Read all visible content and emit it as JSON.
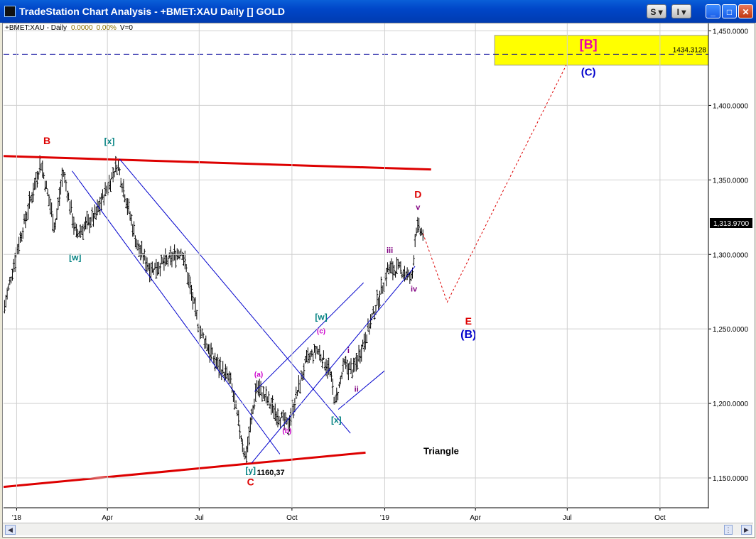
{
  "window": {
    "title": "TradeStation Chart Analysis  -  +BMET:XAU Daily [] GOLD",
    "buttons": [
      "S",
      "I",
      "_",
      "□",
      "✕"
    ]
  },
  "chart_info": {
    "symbol": "+BMET:XAU - Daily",
    "change": "0.0000",
    "change_pct": "0.00%",
    "volume": "V=0"
  },
  "colors": {
    "bars": "#000000",
    "trendlines": "#dd0000",
    "channels": "#0000cc",
    "target_box": "#ffff00",
    "dashed_level": "#000099",
    "projection": "#dd0000"
  },
  "chart_data": {
    "type": "bar",
    "title": "",
    "xlabel": "",
    "ylabel": "",
    "x_ticks": [
      "'18",
      "Apr",
      "Jul",
      "Oct",
      "'19",
      "Apr",
      "Jul",
      "Oct"
    ],
    "y_ticks": [
      "1,150.0000",
      "1,200.0000",
      "1,250.0000",
      "1,300.0000",
      "1,350.0000",
      "1,400.0000",
      "1,450.0000"
    ],
    "y_tick_values": [
      1150,
      1200,
      1250,
      1300,
      1350,
      1400,
      1450
    ],
    "ylim": [
      1130,
      1455
    ],
    "xlim": [
      "2017-12-19",
      "2019-11-18"
    ],
    "price_path": [
      [
        "2017-12-20",
        1265
      ],
      [
        "2018-01-01",
        1302
      ],
      [
        "2018-01-25",
        1362
      ],
      [
        "2018-02-08",
        1318
      ],
      [
        "2018-02-16",
        1356
      ],
      [
        "2018-03-01",
        1313
      ],
      [
        "2018-03-20",
        1326
      ],
      [
        "2018-04-11",
        1361
      ],
      [
        "2018-05-01",
        1305
      ],
      [
        "2018-05-14",
        1290
      ],
      [
        "2018-06-01",
        1296
      ],
      [
        "2018-06-14",
        1303
      ],
      [
        "2018-07-01",
        1250
      ],
      [
        "2018-07-17",
        1228
      ],
      [
        "2018-08-01",
        1215
      ],
      [
        "2018-08-16",
        1163
      ],
      [
        "2018-08-27",
        1212
      ],
      [
        "2018-09-15",
        1194
      ],
      [
        "2018-09-27",
        1185
      ],
      [
        "2018-10-15",
        1228
      ],
      [
        "2018-10-26",
        1236
      ],
      [
        "2018-11-07",
        1223
      ],
      [
        "2018-11-13",
        1200
      ],
      [
        "2018-11-22",
        1226
      ],
      [
        "2018-12-01",
        1222
      ],
      [
        "2018-12-20",
        1258
      ],
      [
        "2019-01-04",
        1290
      ],
      [
        "2019-01-17",
        1290
      ],
      [
        "2019-01-28",
        1283
      ],
      [
        "2019-02-01",
        1318
      ],
      [
        "2019-02-08",
        1314
      ]
    ],
    "last_price": "1,313.9700",
    "low_label": "1160,37",
    "target_value": "1434.3128",
    "target_level": 1434.3128,
    "target_zone": {
      "x_start": "2019-04-20",
      "x_end": "2019-11-18",
      "y_low": 1427,
      "y_high": 1447
    },
    "trendlines": [
      {
        "name": "upper-red",
        "p1": [
          "2017-12-19",
          1366
        ],
        "p2": [
          "2019-02-16",
          1357
        ]
      },
      {
        "name": "lower-red",
        "p1": [
          "2017-12-19",
          1144
        ],
        "p2": [
          "2018-12-13",
          1167
        ]
      }
    ],
    "channels": [
      {
        "p1": [
          "2018-02-25",
          1356
        ],
        "p2": [
          "2018-09-19",
          1166
        ]
      },
      {
        "p1": [
          "2018-04-13",
          1364
        ],
        "p2": [
          "2018-11-28",
          1180
        ]
      },
      {
        "p1": [
          "2018-08-22",
          1160
        ],
        "p2": [
          "2019-01-31",
          1292
        ]
      },
      {
        "p1": [
          "2018-08-25",
          1208
        ],
        "p2": [
          "2018-12-11",
          1281
        ]
      },
      {
        "p1": [
          "2018-11-16",
          1196
        ],
        "p2": [
          "2019-01-01",
          1222
        ]
      }
    ],
    "projection": [
      [
        "2019-02-08",
        1314
      ],
      [
        "2019-03-04",
        1268
      ],
      [
        "2019-06-30",
        1427
      ]
    ],
    "annotations": [
      {
        "text": "B",
        "x": "2018-01-31",
        "y": 1374,
        "color": "#dd0000",
        "size": 14
      },
      {
        "text": "[x]",
        "x": "2018-04-03",
        "y": 1374,
        "color": "#008080",
        "size": 12
      },
      {
        "text": "[w]",
        "x": "2018-02-28",
        "y": 1296,
        "color": "#008080",
        "size": 12
      },
      {
        "text": "D",
        "x": "2019-02-03",
        "y": 1338,
        "color": "#dd0000",
        "size": 14
      },
      {
        "text": "v",
        "x": "2019-02-03",
        "y": 1330,
        "color": "#800080",
        "size": 11
      },
      {
        "text": "iii",
        "x": "2019-01-06",
        "y": 1301,
        "color": "#800080",
        "size": 11
      },
      {
        "text": "iv",
        "x": "2019-01-30",
        "y": 1275,
        "color": "#800080",
        "size": 11
      },
      {
        "text": "i",
        "x": "2018-11-26",
        "y": 1234,
        "color": "#800080",
        "size": 11
      },
      {
        "text": "ii",
        "x": "2018-12-04",
        "y": 1208,
        "color": "#800080",
        "size": 11
      },
      {
        "text": "[w]",
        "x": "2018-10-30",
        "y": 1256,
        "color": "#008080",
        "size": 12
      },
      {
        "text": "(c)",
        "x": "2018-10-30",
        "y": 1247,
        "color": "#cc00cc",
        "size": 10
      },
      {
        "text": "(a)",
        "x": "2018-08-29",
        "y": 1218,
        "color": "#cc00cc",
        "size": 10
      },
      {
        "text": "(b)",
        "x": "2018-09-26",
        "y": 1180,
        "color": "#cc00cc",
        "size": 10
      },
      {
        "text": "[x]",
        "x": "2018-11-14",
        "y": 1187,
        "color": "#008080",
        "size": 12
      },
      {
        "text": "[y]",
        "x": "2018-08-21",
        "y": 1153,
        "color": "#008080",
        "size": 12
      },
      {
        "text": "C",
        "x": "2018-08-21",
        "y": 1145,
        "color": "#dd0000",
        "size": 14
      },
      {
        "text": "1160,37",
        "x": "2018-09-10",
        "y": 1152,
        "color": "#000000",
        "size": 11
      },
      {
        "text": "E",
        "x": "2019-03-25",
        "y": 1253,
        "color": "#dd0000",
        "size": 14
      },
      {
        "text": "(B)",
        "x": "2019-03-25",
        "y": 1244,
        "color": "#0000cc",
        "size": 16
      },
      {
        "text": "Triangle",
        "x": "2019-02-26",
        "y": 1166,
        "color": "#000000",
        "size": 13
      },
      {
        "text": "[B]",
        "x": "2019-07-22",
        "y": 1438,
        "color": "#ee00aa",
        "size": 18
      },
      {
        "text": "(C)",
        "x": "2019-07-22",
        "y": 1420,
        "color": "#0000cc",
        "size": 15
      }
    ]
  }
}
